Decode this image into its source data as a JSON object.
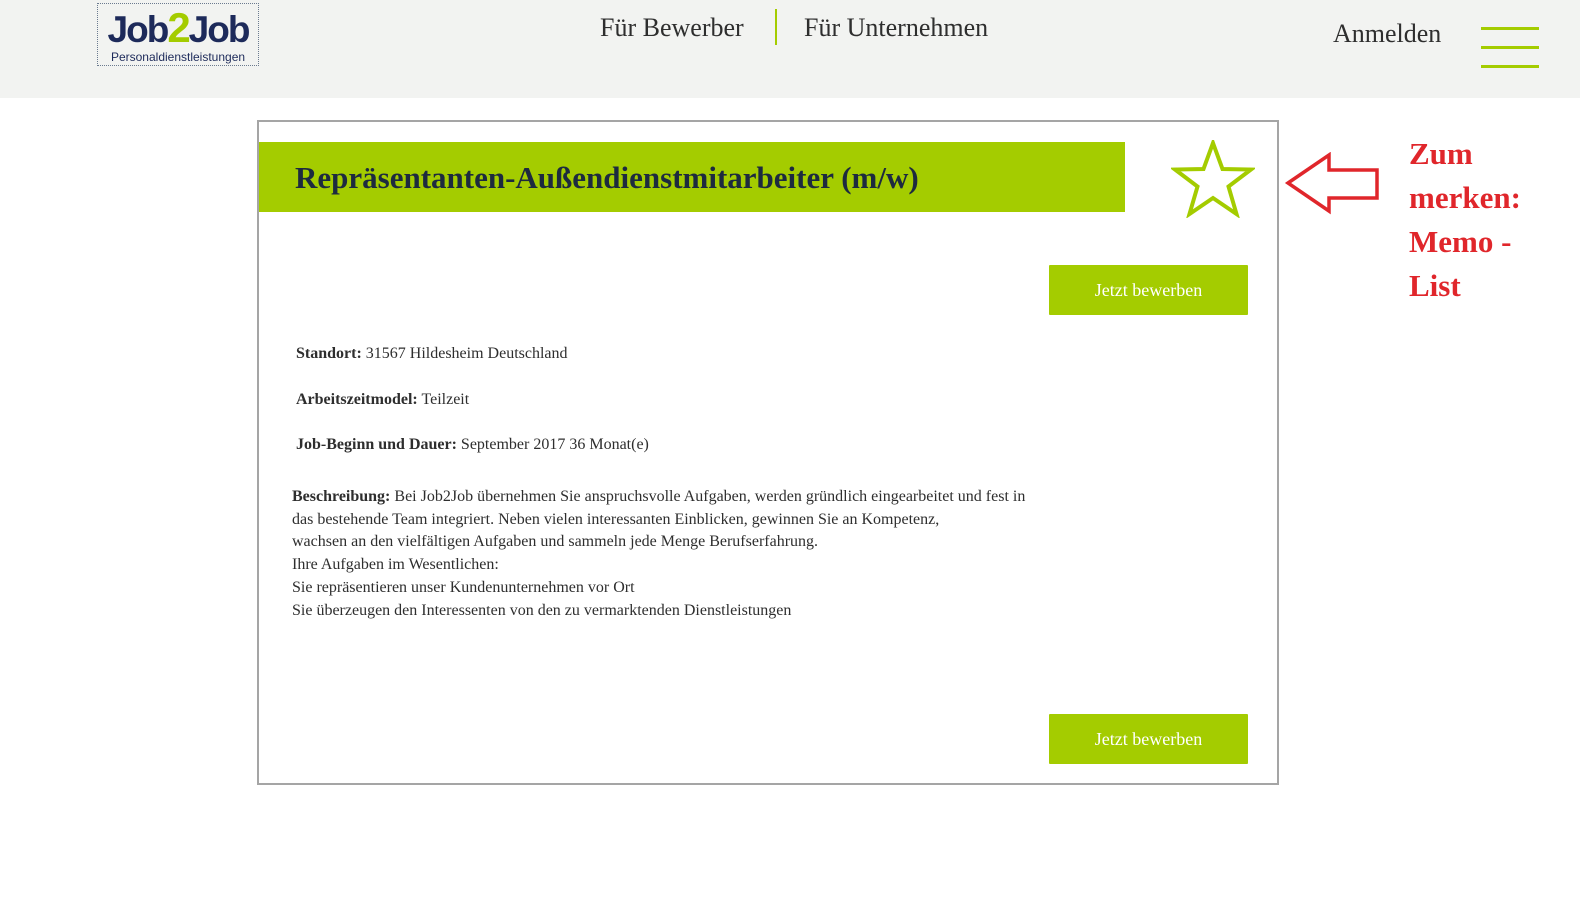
{
  "header": {
    "logo": {
      "word_left": "Job",
      "word_mid": "2",
      "word_right": "Job",
      "subtitle": "Personaldienstleistungen"
    },
    "nav": {
      "applicants": "Für Bewerber",
      "companies": "Für Unternehmen"
    },
    "login": "Anmelden",
    "menu_icon": "hamburger-menu-icon"
  },
  "job": {
    "title": "Repräsentanten-Außendienstmitarbeiter (m/w)",
    "favorite_icon": "star-outline-icon",
    "apply_label": "Jetzt bewerben",
    "location": {
      "label": "Standort:",
      "value": "31567 Hildesheim Deutschland"
    },
    "work_model": {
      "label": "Arbeitszeitmodel:",
      "value": "Teilzeit"
    },
    "start": {
      "label": "Job-Beginn und Dauer:",
      "value": "September 2017 36 Monat(e)"
    },
    "description": {
      "label": "Beschreibung:",
      "line1": "Bei Job2Job übernehmen Sie anspruchsvolle Aufgaben, werden gründlich eingearbeitet und fest in",
      "line2": "das bestehende Team integriert. Neben vielen interessanten Einblicken, gewinnen Sie an Kompetenz,",
      "line3": "wachsen an den vielfältigen Aufgaben und sammeln jede Menge Berufserfahrung.",
      "line4": "Ihre Aufgaben im Wesentlichen:",
      "line5": "Sie repräsentieren unser Kundenunternehmen vor Ort",
      "line6": "Sie überzeugen den Interessenten von den zu vermarktenden Dienstleistungen"
    }
  },
  "annotation": {
    "arrow_icon": "left-arrow-icon",
    "line1": "Zum",
    "line2": "merken:",
    "line3": "Memo -",
    "line4": "List"
  },
  "colors": {
    "accent_green": "#a4cc00",
    "brand_navy": "#1d2a5a",
    "annotation_red": "#e0262b",
    "header_bg": "#f2f3f1"
  }
}
